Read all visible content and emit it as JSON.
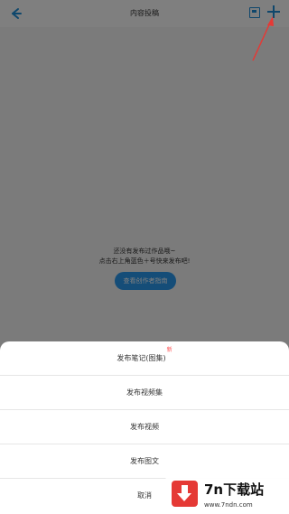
{
  "header": {
    "title": "内容投稿"
  },
  "empty_state": {
    "line1": "还没有发布过作品哦~",
    "line2": "点击右上角蓝色＋号快来发布吧!",
    "button": "查看创作者指南"
  },
  "sheet": {
    "items": [
      {
        "label": "发布笔记(图集)",
        "badge": "新"
      },
      {
        "label": "发布视频集"
      },
      {
        "label": "发布视频"
      },
      {
        "label": "发布图文"
      },
      {
        "label": "取消"
      }
    ]
  },
  "watermark": {
    "title": "7n下载站",
    "url": "www.7ndn.com"
  },
  "colors": {
    "accent": "#1f8fd8",
    "annotation": "#e53935",
    "badge": "#ff4d4f"
  }
}
